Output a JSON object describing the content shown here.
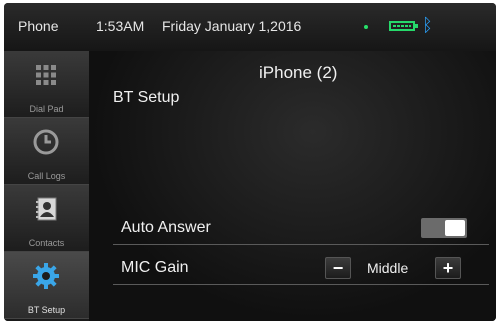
{
  "status_bar": {
    "app_name": "Phone",
    "time": "1:53AM",
    "date": "Friday January 1,2016",
    "bluetooth_icon": "bluetooth-icon",
    "battery_icon": "battery-icon",
    "accent_colors": {
      "battery": "#26d96a",
      "bluetooth": "#2a9df4"
    }
  },
  "sidebar": {
    "items": [
      {
        "label": "Dial Pad",
        "icon": "dialpad-icon"
      },
      {
        "label": "Call Logs",
        "icon": "clock-icon"
      },
      {
        "label": "Contacts",
        "icon": "contacts-book-icon"
      },
      {
        "label": "BT Setup",
        "icon": "gear-icon",
        "active": true
      }
    ]
  },
  "main": {
    "device_name": "iPhone (2)",
    "section_title": "BT Setup",
    "settings": {
      "auto_answer": {
        "label": "Auto Answer",
        "enabled": true
      },
      "mic_gain": {
        "label": "MIC Gain",
        "value": "Middle",
        "decrease": "−",
        "increase": "+"
      }
    }
  }
}
